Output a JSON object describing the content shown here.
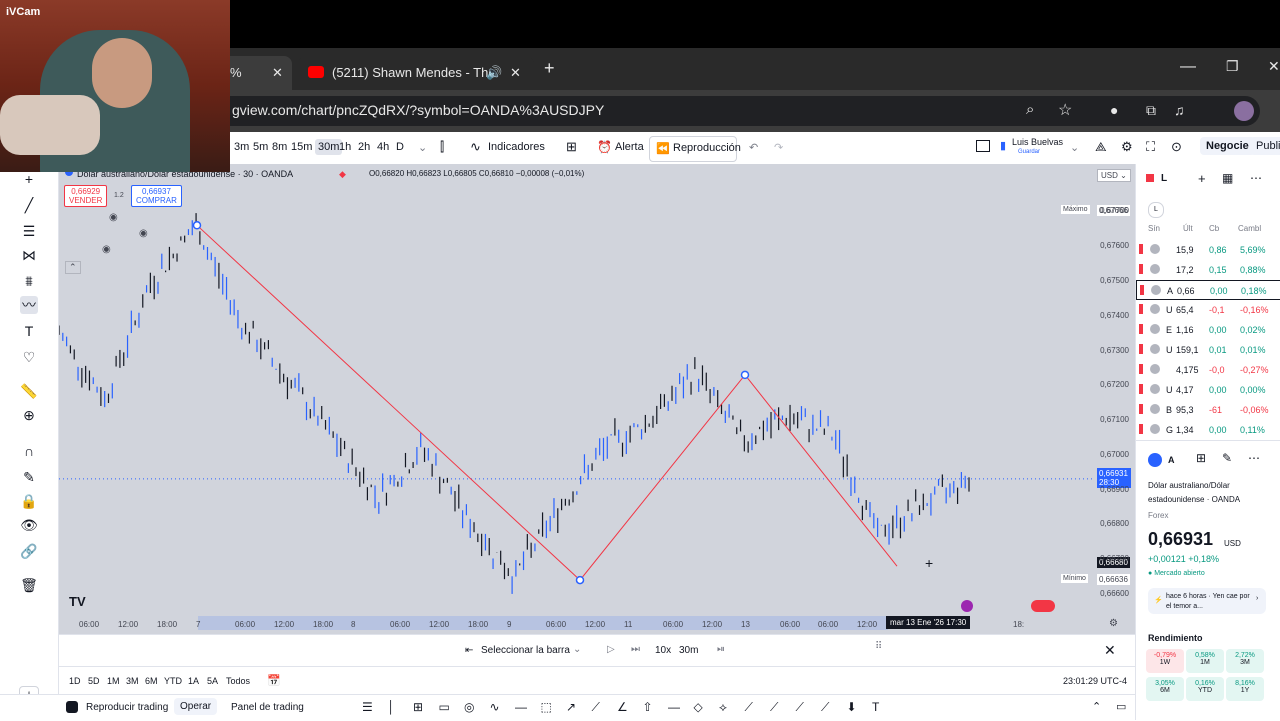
{
  "webcam": {
    "label": "iVCam"
  },
  "browser": {
    "tab1_label": "%",
    "tab2_label": "(5211) Shawn Mendes - The",
    "url": "gview.com/chart/pncZQdRX/?symbol=OANDA%3AUSDJPY"
  },
  "toolbar": {
    "intervals": [
      "3m",
      "5m",
      "8m",
      "15m",
      "30m",
      "1h",
      "2h",
      "4h",
      "D"
    ],
    "indicators": "Indicadores",
    "alert": "Alerta",
    "replay": "Reproducción",
    "user": "Luis Buelvas",
    "user_sub": "Guardar",
    "trade": "Negocie",
    "publish": "Publi"
  },
  "chart": {
    "title": "Dólar australiano/Dólar estadounidense · 30 · OANDA",
    "ohlc": "O0,66820 H0,66823 L0,66805 C0,66810 −0,00008 (−0,01%)",
    "sell_price": "0,66929",
    "sell_label": "VENDER",
    "spread": "1.2",
    "buy_price": "0,66937",
    "buy_label": "COMPRAR",
    "currency": "USD",
    "max_label": "Máximo",
    "max_value": "0,67666",
    "min_label": "Mínimo",
    "min_value": "0,66636",
    "current_price": "0,66931",
    "current_time": "28:30",
    "cursor_price": "0,66680",
    "price_ticks": [
      "0,67700",
      "0,67600",
      "0,67500",
      "0,67400",
      "0,67300",
      "0,67200",
      "0,67100",
      "0,67000",
      "0,66900",
      "0,66800",
      "0,66700",
      "0,66600"
    ],
    "time_ticks": [
      "06:00",
      "12:00",
      "18:00",
      "7",
      "06:00",
      "12:00",
      "18:00",
      "8",
      "06:00",
      "12:00",
      "18:00",
      "9",
      "06:00",
      "12:00",
      "11",
      "06:00",
      "12:00",
      "13",
      "06:00",
      "06:00",
      "12:00",
      "18:"
    ],
    "time_ticks_x": [
      80,
      119,
      158,
      197,
      236,
      275,
      314,
      352,
      391,
      430,
      469,
      508,
      547,
      586,
      625,
      664,
      703,
      742,
      781,
      819,
      858,
      1014,
      1053,
      1087
    ],
    "cursor_time": "mar 13 Ene '26  17:30"
  },
  "chart_data": {
    "type": "line",
    "series": [
      {
        "name": "",
        "values": [
          0.6735,
          0.6716,
          0.6749,
          0.6766,
          0.6738,
          0.6722,
          0.6705,
          0.6688,
          0.6702,
          0.6681,
          0.6665,
          0.6685,
          0.6702,
          0.671,
          0.6724,
          0.6704,
          0.6711,
          0.6706,
          0.6677,
          0.6686,
          0.6693
        ]
      }
    ],
    "zigzag": [
      {
        "x": 0.6766,
        "y": 0.6766
      },
      {
        "x": 0.6664,
        "y": 0.6664
      },
      {
        "x": 0.6723,
        "y": 0.6723
      },
      {
        "x": 0.6668,
        "y": 0.6668
      }
    ],
    "ylim": [
      0.666,
      0.6775
    ]
  },
  "replay": {
    "select_bar": "Seleccionar la barra",
    "speed": "10x",
    "interval": "30m"
  },
  "periods": [
    "1D",
    "5D",
    "1M",
    "3M",
    "6M",
    "YTD",
    "1A",
    "5A",
    "Todos"
  ],
  "clock": "23:01:29 UTC-4",
  "bottom": {
    "replay_trading": "Reproducir trading",
    "operate": "Operar",
    "panel": "Panel de trading"
  },
  "watchlist": {
    "title": "L",
    "headers": [
      "Sín",
      "Últ",
      "Cb",
      "Cambl"
    ],
    "rows": [
      {
        "sym": "",
        "last": "15,9",
        "chg": "0,86",
        "pct": "5,69%",
        "dir": "up"
      },
      {
        "sym": "",
        "last": "17,2",
        "chg": "0,15",
        "pct": "0,88%",
        "dir": "up"
      },
      {
        "sym": "A",
        "last": "0,66",
        "chg": "0,00",
        "pct": "0,18%",
        "dir": "up"
      },
      {
        "sym": "U",
        "last": "65,4",
        "chg": "-0,1",
        "pct": "-0,16%",
        "dir": "down"
      },
      {
        "sym": "E",
        "last": "1,16",
        "chg": "0,00",
        "pct": "0,02%",
        "dir": "up"
      },
      {
        "sym": "U",
        "last": "159,1",
        "chg": "0,01",
        "pct": "0,01%",
        "dir": "up"
      },
      {
        "sym": "",
        "last": "4,175",
        "chg": "-0,0",
        "pct": "-0,27%",
        "dir": "down"
      },
      {
        "sym": "U",
        "last": "4,17",
        "chg": "0,00",
        "pct": "0,00%",
        "dir": "up"
      },
      {
        "sym": "B",
        "last": "95,3",
        "chg": "-61",
        "pct": "-0,06%",
        "dir": "down"
      },
      {
        "sym": "G",
        "last": "1,34",
        "chg": "0,00",
        "pct": "0,11%",
        "dir": "up"
      }
    ],
    "detail": {
      "sym": "A",
      "name": "Dólar australiano/Dólar estadounidense",
      "exchange": "OANDA",
      "category": "Forex",
      "price": "0,66931",
      "price_currency": "USD",
      "change": "+0,00121 +0,18%",
      "market": "Mercado abierto",
      "news": "hace 6 horas · Yen cae por el temor a...",
      "perf_title": "Rendimiento",
      "perf": [
        {
          "v": "-0,79%",
          "l": "1W",
          "dir": "down"
        },
        {
          "v": "0,58%",
          "l": "1M",
          "dir": "up"
        },
        {
          "v": "2,72%",
          "l": "3M",
          "dir": "up"
        },
        {
          "v": "3,05%",
          "l": "6M",
          "dir": "up"
        },
        {
          "v": "0,16%",
          "l": "YTD",
          "dir": "up"
        },
        {
          "v": "8,16%",
          "l": "1Y",
          "dir": "up"
        }
      ]
    }
  }
}
